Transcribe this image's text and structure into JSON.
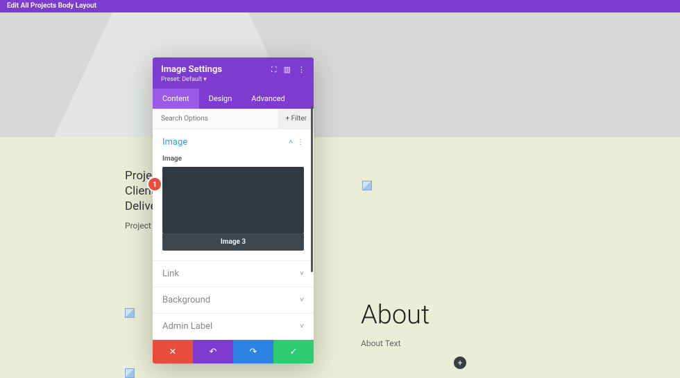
{
  "topbar": {
    "title": "Edit All Projects Body Layout"
  },
  "page": {
    "project": {
      "line1": "Project Name",
      "line2": "Client Name",
      "line3": "Delivery Date",
      "desc": "Project Description"
    },
    "about": {
      "heading": "About",
      "text": "About Text"
    },
    "add_icon": "+"
  },
  "modal": {
    "title": "Image Settings",
    "preset": "Preset: Default ▾",
    "icons": {
      "expand": "⛶",
      "drag": "▥",
      "more": "⋮"
    },
    "tabs": [
      {
        "label": "Content",
        "active": true
      },
      {
        "label": "Design",
        "active": false
      },
      {
        "label": "Advanced",
        "active": false
      }
    ],
    "search_placeholder": "Search Options",
    "filter_label": "Filter",
    "sections": {
      "image": {
        "title": "Image",
        "field_label": "Image",
        "caption": "Image 3"
      },
      "link": {
        "title": "Link"
      },
      "background": {
        "title": "Background"
      },
      "admin": {
        "title": "Admin Label"
      }
    },
    "actions": {
      "delete": "✕",
      "undo": "↶",
      "redo": "↷",
      "save": "✓"
    }
  },
  "badge": {
    "number": "1"
  }
}
